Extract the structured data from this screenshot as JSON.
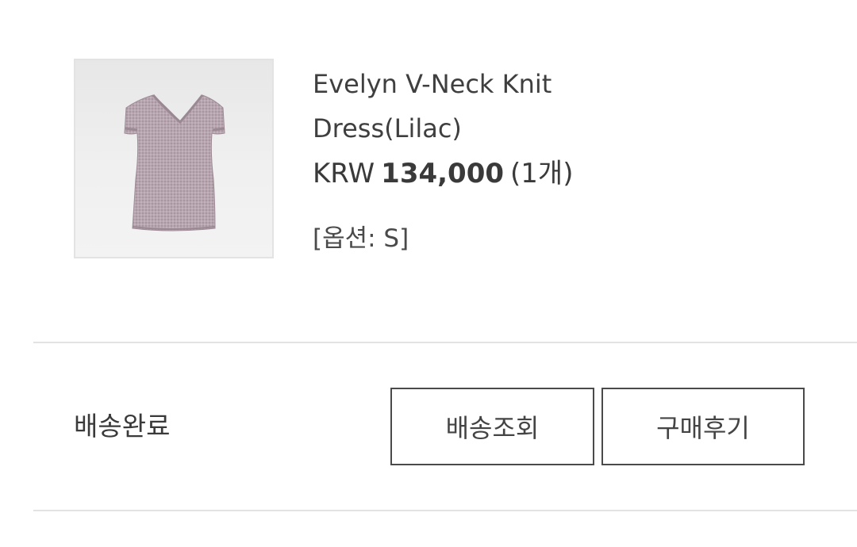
{
  "product": {
    "image_icon": "lilac-knit-dress-photo",
    "name": "Evelyn V-Neck Knit Dress(Lilac)",
    "price": {
      "currency": "KRW",
      "amount": "134,000",
      "quantity": "(1개)"
    },
    "option": "[옵션: S]",
    "colors": {
      "garment": "#b3a1ab"
    }
  },
  "order": {
    "status": "배송완료",
    "buttons": {
      "track": "배송조회",
      "review": "구매후기"
    }
  }
}
